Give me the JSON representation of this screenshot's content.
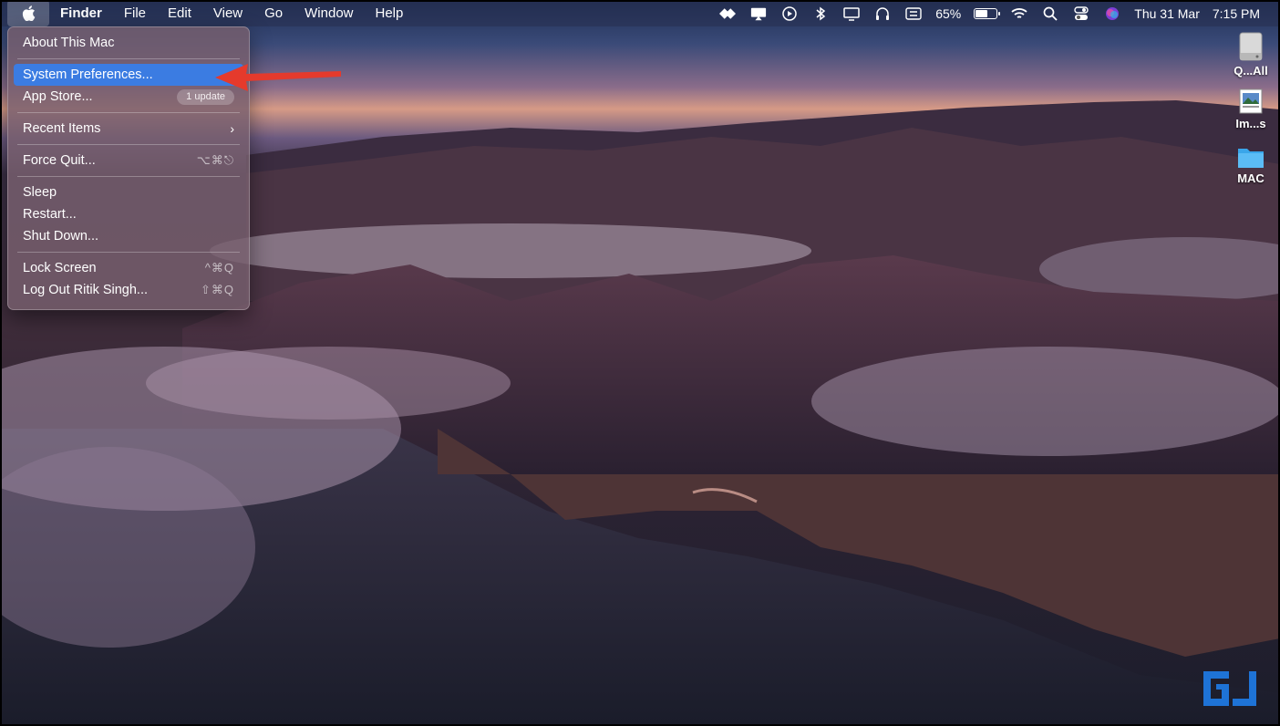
{
  "menubar": {
    "items": [
      "Finder",
      "File",
      "Edit",
      "View",
      "Go",
      "Window",
      "Help"
    ],
    "status": {
      "battery_percent": "65%",
      "battery_level": 0.65,
      "date": "Thu 31 Mar",
      "time": "7:15 PM",
      "icons": [
        "messenger-icon",
        "screen-mirror-icon",
        "play-icon",
        "bluetooth-icon",
        "display-icon",
        "headphones-icon",
        "keyboard-input-icon",
        "battery-icon",
        "wifi-icon",
        "spotlight-search-icon",
        "control-center-icon",
        "siri-icon"
      ]
    }
  },
  "apple_menu": {
    "about": "About This Mac",
    "system_preferences": "System Preferences...",
    "app_store": "App Store...",
    "app_store_badge": "1 update",
    "recent_items": "Recent Items",
    "force_quit": "Force Quit...",
    "force_quit_shortcut": "⌥⌘⎋",
    "sleep": "Sleep",
    "restart": "Restart...",
    "shut_down": "Shut Down...",
    "lock_screen": "Lock Screen",
    "lock_screen_shortcut": "^⌘Q",
    "log_out": "Log Out Ritik Singh...",
    "log_out_shortcut": "⇧⌘Q"
  },
  "desktop": {
    "icons": [
      {
        "label": "Q...All",
        "icon": "disk-icon"
      },
      {
        "label": "Im...s",
        "icon": "image-file-icon"
      },
      {
        "label": "MAC",
        "icon": "folder-icon"
      }
    ]
  },
  "colors": {
    "menu_highlight": "#3b7ce2",
    "annotation_arrow": "#e53a2c",
    "watermark": "#1e73d6"
  }
}
